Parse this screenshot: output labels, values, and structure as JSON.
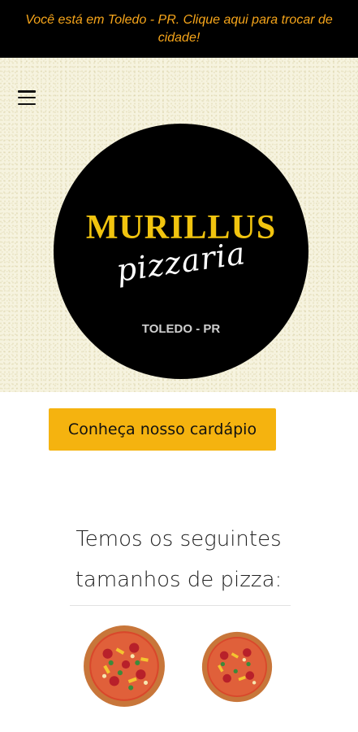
{
  "city_bar": {
    "text": "Você está em Toledo - PR. Clique aqui para trocar de cidade!"
  },
  "header": {
    "menu_icon": "hamburger-menu-icon"
  },
  "logo": {
    "title": "MURILLUS",
    "subtitle": "pizzaria",
    "city": "TOLEDO - PR"
  },
  "menu_button": {
    "label": "Conheça nosso cardápio"
  },
  "sizes_section": {
    "title_line1": "Temos os seguintes",
    "title_line2": "tamanhos de pizza:"
  },
  "colors": {
    "accent": "#f5b30f",
    "top_bar_text": "#f6a51a",
    "logo_gold": "#f1c40f"
  }
}
